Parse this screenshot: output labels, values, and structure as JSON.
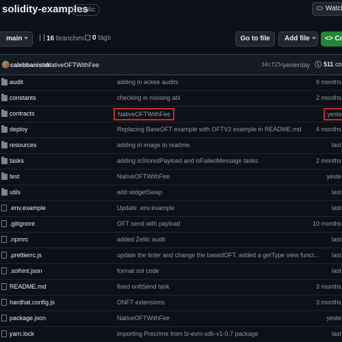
{
  "repo": {
    "name": "solidity-examples",
    "visibility": "Public"
  },
  "actions": {
    "watch": "Watch"
  },
  "toolbar": {
    "branch": "main",
    "branches_count": "16",
    "branches_label": "branches",
    "tags_count": "0",
    "tags_label": "tags",
    "goto_file": "Go to file",
    "add_file": "Add file",
    "code": "Co"
  },
  "latest_commit": {
    "author": "calebbanister",
    "message": "NativeOFTWithFee",
    "hash": "34cf25c",
    "time": "yesterday",
    "count": "511",
    "count_label": "com"
  },
  "files": [
    {
      "name": "audit",
      "type": "folder",
      "message": "adding in ackee audits",
      "age": "9 months",
      "highlight": false
    },
    {
      "name": "constants",
      "type": "folder",
      "message": "checking in missing abi",
      "age": "2 months",
      "highlight": false
    },
    {
      "name": "contracts",
      "type": "folder",
      "message": "NativeOFTWithFee",
      "age": "yeste",
      "highlight": true
    },
    {
      "name": "deploy",
      "type": "folder",
      "message": "Replacing BaseOFT example with OFTV2 example in README.md",
      "age": "4 months",
      "highlight": false
    },
    {
      "name": "resources",
      "type": "folder",
      "message": "adding in image to readme",
      "age": "last",
      "highlight": false
    },
    {
      "name": "tasks",
      "type": "folder",
      "message": "adding isStoredPayload and isFailedMessage tasks",
      "age": "2 months",
      "highlight": false
    },
    {
      "name": "test",
      "type": "folder",
      "message": "NativeOFTWithFee",
      "age": "yeste",
      "highlight": false
    },
    {
      "name": "utils",
      "type": "folder",
      "message": "add widgetSwap",
      "age": "last",
      "highlight": false
    },
    {
      "name": ".env.example",
      "type": "file",
      "message": "Update .env.example",
      "age": "last",
      "highlight": false
    },
    {
      "name": ".gitignore",
      "type": "file",
      "message": "OFT send with payload",
      "age": "10 months",
      "highlight": false
    },
    {
      "name": ".npmrc",
      "type": "file",
      "message": "added Zellic audit",
      "age": "last",
      "highlight": false
    },
    {
      "name": ".prettierrc.js",
      "type": "file",
      "message": "update the linter and change the basedOFT. added a getType view funct...",
      "age": "last",
      "highlight": false
    },
    {
      "name": ".solhint.json",
      "type": "file",
      "message": "format sol code",
      "age": "last",
      "highlight": false
    },
    {
      "name": "README.md",
      "type": "file",
      "message": "fixed onftSend task",
      "age": "3 months",
      "highlight": false
    },
    {
      "name": "hardhat.config.js",
      "type": "file",
      "message": "ONFT extensions",
      "age": "3 months",
      "highlight": false
    },
    {
      "name": "package.json",
      "type": "file",
      "message": "NativeOFTWithFee",
      "age": "yeste",
      "highlight": false
    },
    {
      "name": "yarn.lock",
      "type": "file",
      "message": "importing Precrime from lz-evm-sdk-v1-0.7 package",
      "age": "last",
      "highlight": false
    }
  ],
  "colors": {
    "background": "#0d1117",
    "border": "#3d444d",
    "muted_text": "#9198a1",
    "primary_button": "#238636",
    "highlight_box": "#d42a2a"
  }
}
